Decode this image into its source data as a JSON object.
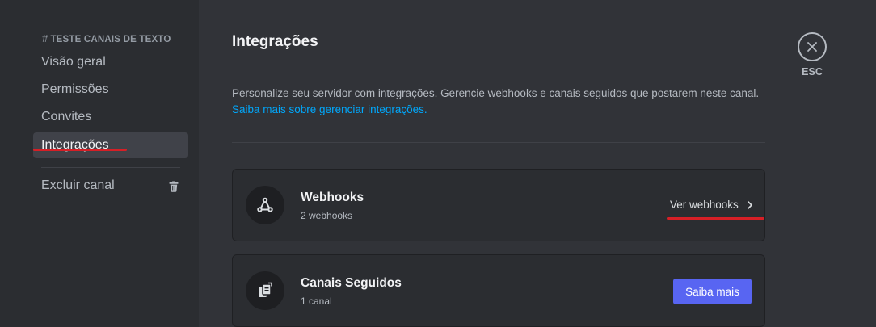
{
  "sidebar": {
    "header_hash": "#",
    "header": "TESTE CANAIS DE TEXTO",
    "items": [
      {
        "label": "Visão geral"
      },
      {
        "label": "Permissões"
      },
      {
        "label": "Convites"
      },
      {
        "label": "Integrações",
        "active": true
      }
    ],
    "delete_label": "Excluir canal"
  },
  "main": {
    "title": "Integrações",
    "description": "Personalize seu servidor com integrações. Gerencie webhooks e canais seguidos que postarem neste canal.",
    "learn_more_link": "Saiba mais sobre gerenciar integrações.",
    "cards": [
      {
        "title": "Webhooks",
        "subtitle": "2 webhooks",
        "action": "Ver webhooks",
        "icon": "webhook-icon"
      },
      {
        "title": "Canais Seguidos",
        "subtitle": "1 canal",
        "action": "Saiba mais",
        "icon": "followed-channels-icon"
      }
    ]
  },
  "close": {
    "label": "ESC"
  },
  "colors": {
    "accent": "#5865f2",
    "link": "#00a8fc",
    "annotation_red": "#d61f26"
  }
}
